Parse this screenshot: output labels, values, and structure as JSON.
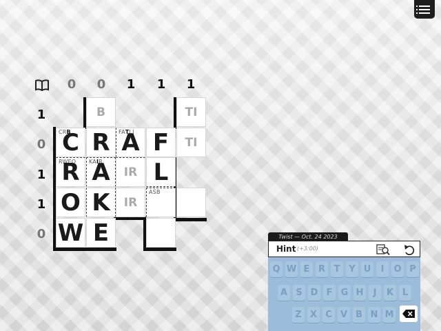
{
  "column_counts": [
    "0",
    "0",
    "1",
    "1",
    "1"
  ],
  "row_counts": [
    "1",
    "0",
    "1",
    "1",
    "0"
  ],
  "grid": {
    "r0c1": {
      "ghost": "B"
    },
    "r0c4": {
      "ghost": "TI"
    },
    "r1c0": {
      "letter": "C",
      "clue_prefix": "CR",
      "clue_bold": "B"
    },
    "r1c1": {
      "letter": "R"
    },
    "r1c2": {
      "letter": "A",
      "clue_prefix": "FA",
      "clue_bold": "T",
      "clue_suffix": "LI"
    },
    "r1c3": {
      "letter": "F"
    },
    "r1c4": {
      "ghost": "TI"
    },
    "r2c0": {
      "letter": "R",
      "clue_prefix": "RWEO",
      "clue_bold": ""
    },
    "r2c1": {
      "letter": "A",
      "clue_prefix": "KA",
      "clue_bold": "I",
      "clue_suffix": "R"
    },
    "r2c2": {
      "ghost": "IR"
    },
    "r2c3": {
      "letter": "L"
    },
    "r3c0": {
      "letter": "O"
    },
    "r3c1": {
      "letter": "K"
    },
    "r3c2": {
      "ghost": "IR"
    },
    "r3c3": {
      "clue_prefix": "ASB",
      "clue_bold": ""
    },
    "r4c0": {
      "letter": "W"
    },
    "r4c1": {
      "letter": "E"
    }
  },
  "panel": {
    "tab_label": "Twist — Oct. 24 2023",
    "hint_label": "Hint",
    "hint_extra": "(+3:00)"
  },
  "keyboard": {
    "row1": [
      "Q",
      "W",
      "E",
      "R",
      "T",
      "Y",
      "U",
      "I",
      "O",
      "P"
    ],
    "row2": [
      "A",
      "S",
      "D",
      "F",
      "G",
      "H",
      "J",
      "K",
      "L"
    ],
    "row3": [
      "Z",
      "X",
      "C",
      "V",
      "B",
      "N",
      "M"
    ]
  },
  "icons": {
    "menu": "list-menu-icon",
    "book": "book-icon",
    "hint": "hint-magnifier-icon",
    "undo": "undo-icon",
    "delete": "backspace-icon"
  }
}
